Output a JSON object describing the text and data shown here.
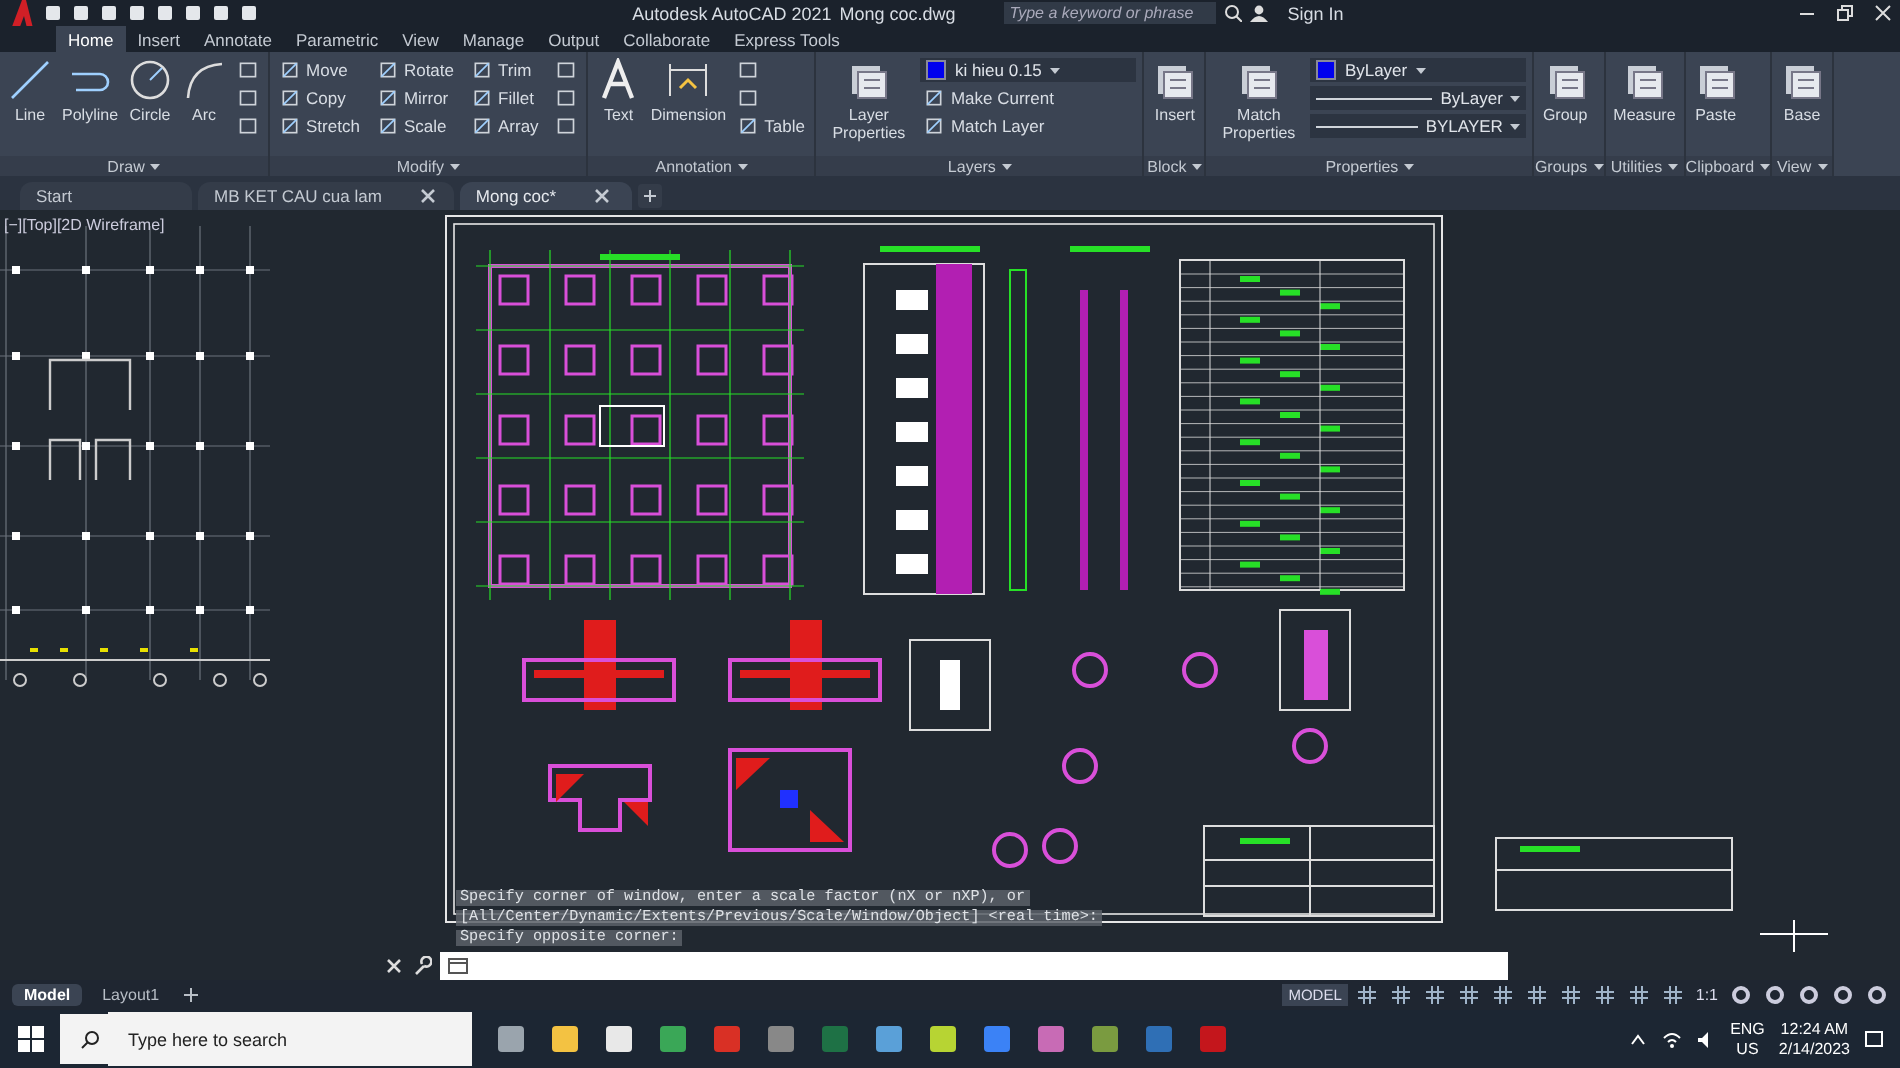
{
  "title_bar": {
    "app": "Autodesk AutoCAD 2021",
    "document": "Mong coc.dwg",
    "search": {
      "placeholder": "Type a keyword or phrase"
    },
    "sign_in": "Sign In"
  },
  "ribbon_tabs": [
    {
      "label": "Home",
      "selected": true
    },
    {
      "label": "Insert",
      "selected": false
    },
    {
      "label": "Annotate",
      "selected": false
    },
    {
      "label": "Parametric",
      "selected": false
    },
    {
      "label": "View",
      "selected": false
    },
    {
      "label": "Manage",
      "selected": false
    },
    {
      "label": "Output",
      "selected": false
    },
    {
      "label": "Collaborate",
      "selected": false
    },
    {
      "label": "Express Tools",
      "selected": false
    }
  ],
  "ribbon_panels": [
    {
      "title": "Draw",
      "tools": [
        {
          "kind": "large",
          "label": "Line"
        },
        {
          "kind": "large",
          "label": "Polyline"
        },
        {
          "kind": "large",
          "label": "Circle"
        },
        {
          "kind": "large",
          "label": "Arc"
        },
        {
          "kind": "icon"
        },
        {
          "kind": "icon"
        },
        {
          "kind": "icon"
        }
      ]
    },
    {
      "title": "Modify",
      "tools": [
        {
          "kind": "small",
          "label": "Move"
        },
        {
          "kind": "small",
          "label": "Copy"
        },
        {
          "kind": "small",
          "label": "Stretch"
        },
        {
          "kind": "small",
          "label": "Rotate"
        },
        {
          "kind": "small",
          "label": "Mirror"
        },
        {
          "kind": "small",
          "label": "Scale"
        },
        {
          "kind": "small",
          "label": "Trim"
        },
        {
          "kind": "small",
          "label": "Fillet"
        },
        {
          "kind": "small",
          "label": "Array"
        },
        {
          "kind": "icon"
        },
        {
          "kind": "icon"
        },
        {
          "kind": "icon"
        }
      ]
    },
    {
      "title": "Annotation",
      "tools": [
        {
          "kind": "large",
          "label": "Text"
        },
        {
          "kind": "large",
          "label": "Dimension"
        },
        {
          "kind": "icon"
        },
        {
          "kind": "icon"
        },
        {
          "kind": "small",
          "label": "Table"
        }
      ]
    },
    {
      "title": "Layers",
      "tools": [
        {
          "kind": "large",
          "label": "Layer Properties"
        },
        {
          "kind": "dropdown",
          "label": "ki hieu 0.15"
        },
        {
          "kind": "small",
          "label": "Make Current"
        },
        {
          "kind": "small",
          "label": "Match Layer"
        }
      ]
    },
    {
      "title": "Block",
      "tools": [
        {
          "kind": "large",
          "label": "Insert"
        }
      ]
    },
    {
      "title": "Properties",
      "tools": [
        {
          "kind": "large",
          "label": "Match Properties"
        },
        {
          "kind": "dropdown",
          "label": "ByLayer"
        },
        {
          "kind": "dropdown",
          "label": "ByLayer"
        },
        {
          "kind": "dropdown",
          "label": "BYLAYER"
        }
      ]
    },
    {
      "title": "Groups",
      "tools": [
        {
          "kind": "large",
          "label": "Group"
        }
      ]
    },
    {
      "title": "Utilities",
      "tools": [
        {
          "kind": "large",
          "label": "Measure"
        }
      ]
    },
    {
      "title": "Clipboard",
      "tools": [
        {
          "kind": "large",
          "label": "Paste"
        }
      ]
    },
    {
      "title": "View",
      "tools": [
        {
          "kind": "large",
          "label": "Base"
        }
      ]
    }
  ],
  "file_tabs": [
    {
      "label": "Start",
      "selected": false,
      "closable": false
    },
    {
      "label": "MB KET CAU cua lam",
      "selected": false,
      "closable": true
    },
    {
      "label": "Mong coc*",
      "selected": true,
      "closable": true
    }
  ],
  "viewport": {
    "label": "[−][Top][2D Wireframe]"
  },
  "command_history": [
    "Specify corner of window, enter a scale factor (nX or nXP), or",
    "[All/Center/Dynamic/Extents/Previous/Scale/Window/Object] <real time>:",
    "Specify opposite corner:"
  ],
  "layout_tabs": [
    {
      "label": "Model",
      "selected": true
    },
    {
      "label": "Layout1",
      "selected": false
    }
  ],
  "status_bar": {
    "mode": "MODEL",
    "scale": "1:1"
  },
  "taskbar": {
    "search": {
      "placeholder": "Type here to search"
    },
    "language": "ENG",
    "region": "US",
    "time": "12:24 AM",
    "date": "2/14/2023"
  }
}
